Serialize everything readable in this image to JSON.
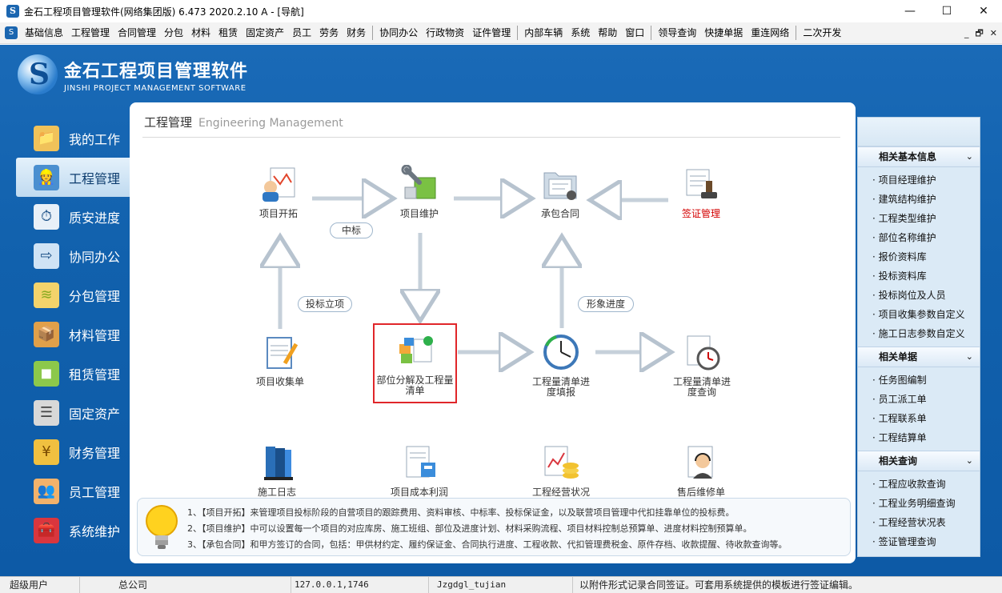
{
  "window": {
    "title": "金石工程项目管理软件(网络集团版) 6.473  2020.2.10 A - [导航]",
    "minimize": "—",
    "maximize": "☐",
    "close": "✕"
  },
  "menubar": {
    "items": [
      "基础信息",
      "工程管理",
      "合同管理",
      "分包",
      "材料",
      "租赁",
      "固定资产",
      "员工",
      "劳务",
      "财务",
      "协同办公",
      "行政物资",
      "证件管理",
      "内部车辆",
      "系统",
      "帮助",
      "窗口",
      "领导查询",
      "快捷单据",
      "重连网络",
      "二次开发"
    ],
    "mdi_min": "_",
    "mdi_restore": "🗗",
    "mdi_close": "✕"
  },
  "logo": {
    "cn": "金石工程项目管理软件",
    "en": "JINSHI PROJECT MANAGEMENT SOFTWARE"
  },
  "leftnav": {
    "items": [
      {
        "label": "我的工作",
        "icon": "folder-user-icon"
      },
      {
        "label": "工程管理",
        "icon": "engineer-icon"
      },
      {
        "label": "质安进度",
        "icon": "clock-progress-icon"
      },
      {
        "label": "协同办公",
        "icon": "office-collab-icon"
      },
      {
        "label": "分包管理",
        "icon": "layers-icon"
      },
      {
        "label": "材料管理",
        "icon": "box-icon"
      },
      {
        "label": "租赁管理",
        "icon": "cubes-icon"
      },
      {
        "label": "固定资产",
        "icon": "server-icon"
      },
      {
        "label": "财务管理",
        "icon": "money-icon"
      },
      {
        "label": "员工管理",
        "icon": "users-icon"
      },
      {
        "label": "系统维护",
        "icon": "toolbox-icon"
      }
    ],
    "active_index": 1
  },
  "content": {
    "title_cn": "工程管理",
    "title_en": "Engineering Management",
    "nodes": {
      "project_start": "项目开拓",
      "project_maintain": "项目维护",
      "contract": "承包合同",
      "visa": "签证管理",
      "project_collect": "项目收集单",
      "decompose": "部位分解及工程量清单",
      "bill_progress": "工程量清单进度填报",
      "bill_query": "工程量清单进度查询",
      "construction_log": "施工日志",
      "cost_profit": "项目成本利润",
      "operation_status": "工程经营状况表",
      "after_sales": "售后维修单"
    },
    "pills": {
      "bid_win": "中标",
      "bid_project": "投标立项",
      "visual_progress": "形象进度"
    },
    "tips": [
      "1、【项目开拓】来管理项目投标阶段的自营项目的跟踪费用、资料审核、中标率、投标保证金，以及联营项目管理中代扣挂靠单位的投标费。",
      "2、【项目维护】中可以设置每一个项目的对应库房、施工班组、部位及进度计划、材料采购流程、项目材料控制总预算单、进度材料控制预算单。",
      "3、【承包合同】和甲方签订的合同，包括：甲供材约定、履约保证金、合同执行进度、工程收款、代扣管理费税金、原件存档、收款提醒、待收款查询等。"
    ]
  },
  "rightpanel": {
    "sections": [
      {
        "title": "相关基本信息",
        "items": [
          "· 项目经理维护",
          "· 建筑结构维护",
          "· 工程类型维护",
          "· 部位名称维护",
          "· 报价资料库",
          "· 投标资料库",
          "· 投标岗位及人员",
          "· 项目收集参数自定义",
          "· 施工日志参数自定义"
        ]
      },
      {
        "title": "相关单据",
        "items": [
          "· 任务图编制",
          "· 员工派工单",
          "· 工程联系单",
          "· 工程结算单"
        ]
      },
      {
        "title": "相关查询",
        "items": [
          "· 工程应收款查询",
          "· 工程业务明细查询",
          "· 工程经营状况表",
          "· 签证管理查询"
        ]
      }
    ],
    "chevron": "⌄"
  },
  "statusbar": {
    "user": "超级用户",
    "company": "总公司",
    "address": "127.0.0.1,1746",
    "db": "Jzgdgl_tujian",
    "hint": "以附件形式记录合同签证。可套用系统提供的模板进行签证编辑。"
  },
  "colors": {
    "main_blue": "#1161ad",
    "accent_red": "#e0262a",
    "panel_bg": "#dbeaf6"
  }
}
